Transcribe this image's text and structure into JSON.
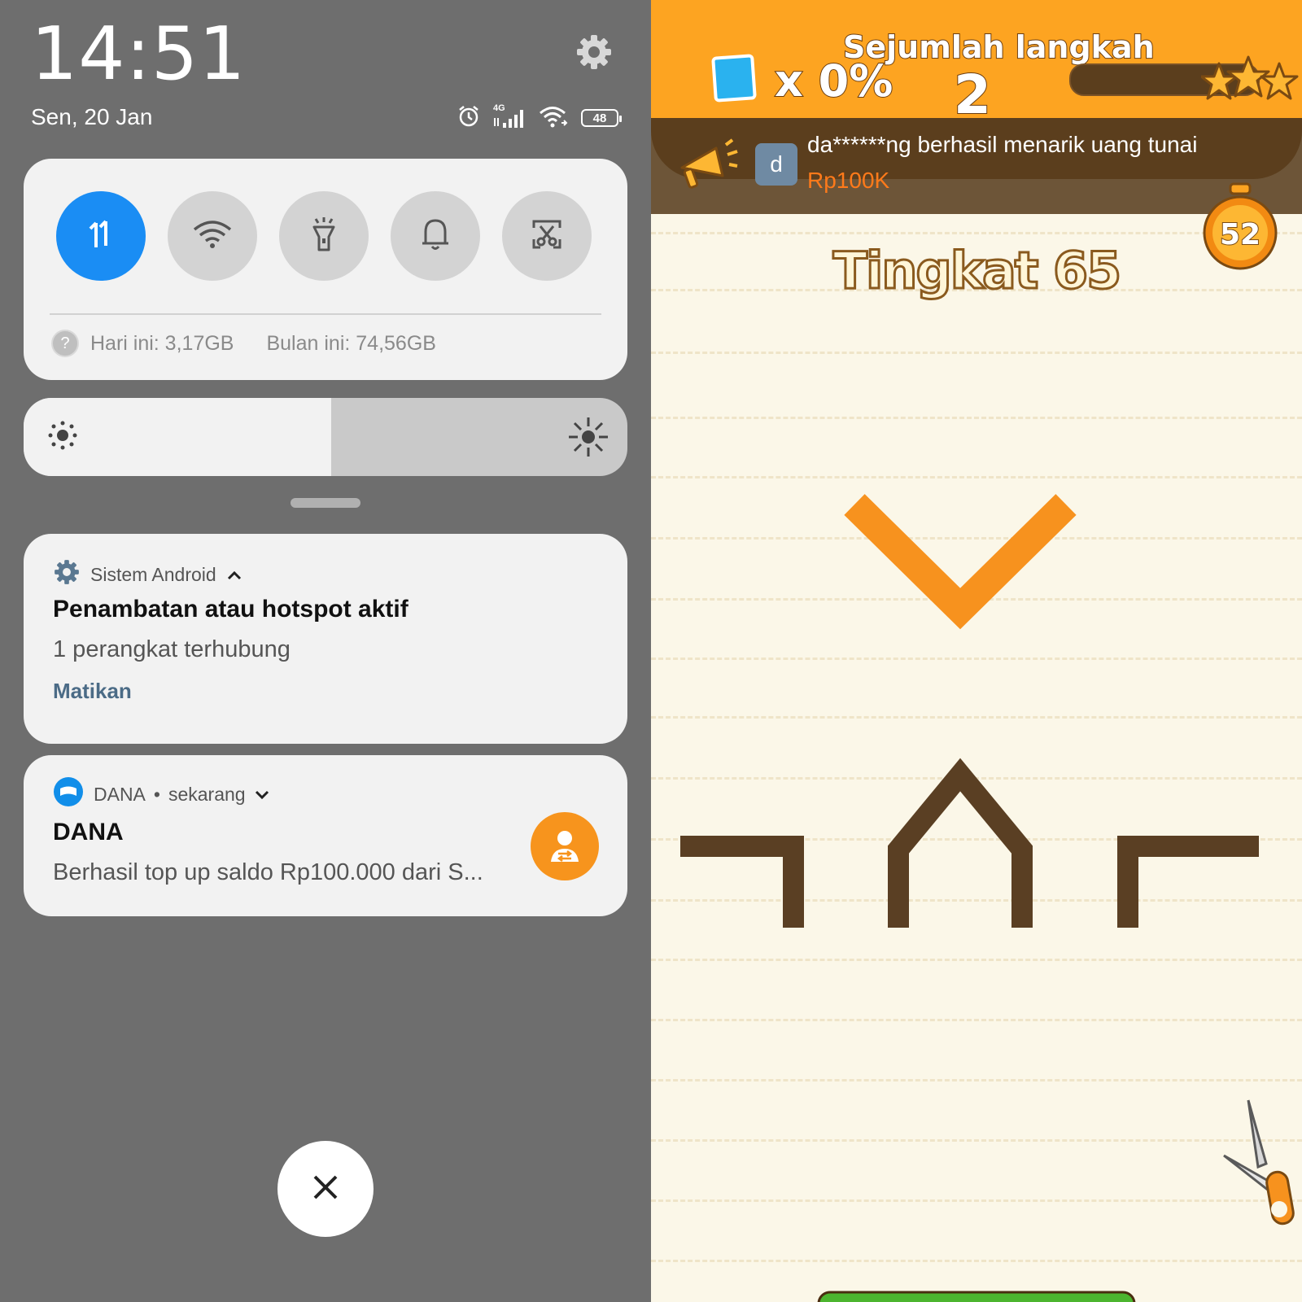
{
  "statusbar": {
    "time": "14:51",
    "date": "Sen, 20 Jan",
    "network_label": "4G",
    "battery": "48"
  },
  "quick_settings": {
    "tiles": [
      {
        "icon": "mobile-data-icon",
        "active": true
      },
      {
        "icon": "wifi-icon",
        "active": false
      },
      {
        "icon": "flashlight-icon",
        "active": false
      },
      {
        "icon": "bell-icon",
        "active": false
      },
      {
        "icon": "screenshot-icon",
        "active": false
      }
    ],
    "usage_today": "Hari ini: 3,17GB",
    "usage_month": "Bulan ini: 74,56GB"
  },
  "brightness": {
    "level": 0.51
  },
  "notifications": [
    {
      "app": "Sistem Android",
      "title": "Penambatan atau hotspot aktif",
      "text": "1 perangkat terhubung",
      "action": "Matikan"
    },
    {
      "app": "DANA",
      "time": "sekarang",
      "title": "DANA",
      "text": "Berhasil top up saldo Rp100.000 dari S..."
    }
  ],
  "game": {
    "multiplier": "x 0%",
    "steps_label": "Sejumlah langkah",
    "steps_value": "2",
    "avatar_letter": "d",
    "ticker_text": "da******ng berhasil menarik uang tunai",
    "ticker_amount": "Rp100K",
    "timer": "52",
    "level": "Tingkat 65",
    "colors": {
      "accent": "#fda421",
      "orange_shape": "#f7921e",
      "brown_shape": "#5a3f23",
      "quick_tile_active": "#1a8df4"
    }
  }
}
